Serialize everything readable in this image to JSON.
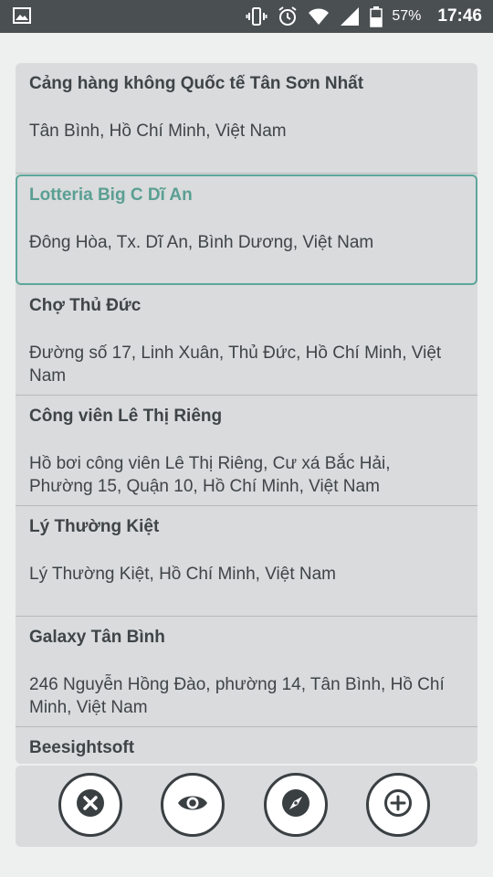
{
  "status_bar": {
    "icons": [
      "image-icon",
      "vibrate-icon",
      "alarm-icon",
      "wifi-icon",
      "signal-icon",
      "battery-icon"
    ],
    "battery": "57%",
    "time": "17:46"
  },
  "places": [
    {
      "name": "Cảng hàng không Quốc tế Tân Sơn Nhất",
      "address": "Tân Bình, Hồ Chí Minh, Việt Nam",
      "selected": false
    },
    {
      "name": "Lotteria Big C Dĩ An",
      "address": "Đông Hòa, Tx. Dĩ An, Bình Dương, Việt Nam",
      "selected": true
    },
    {
      "name": "Chợ Thủ Đức",
      "address": "Đường số 17, Linh Xuân, Thủ Đức, Hồ Chí Minh, Việt Nam",
      "selected": false
    },
    {
      "name": "Công viên Lê Thị Riêng",
      "address": "Hồ bơi công viên Lê Thị Riêng, Cư xá Bắc Hải, Phường 15, Quận 10, Hồ Chí Minh, Việt Nam",
      "selected": false
    },
    {
      "name": "Lý Thường Kiệt",
      "address": "Lý Thường Kiệt, Hồ Chí Minh, Việt Nam",
      "selected": false
    },
    {
      "name": "Galaxy Tân Bình",
      "address": "246 Nguyễn Hồng Đào, phường 14, Tân Bình, Hồ Chí Minh, Việt Nam",
      "selected": false
    },
    {
      "name": "Beesightsoft",
      "address": "",
      "selected": false
    }
  ],
  "actions": [
    {
      "name": "close",
      "icon": "close-icon"
    },
    {
      "name": "view",
      "icon": "eye-icon"
    },
    {
      "name": "navigate",
      "icon": "compass-icon"
    },
    {
      "name": "add",
      "icon": "plus-icon"
    }
  ],
  "colors": {
    "accent": "#5da79b",
    "status_bar": "#4a4f52",
    "card": "#d9dbdc",
    "text": "#3f4447"
  }
}
